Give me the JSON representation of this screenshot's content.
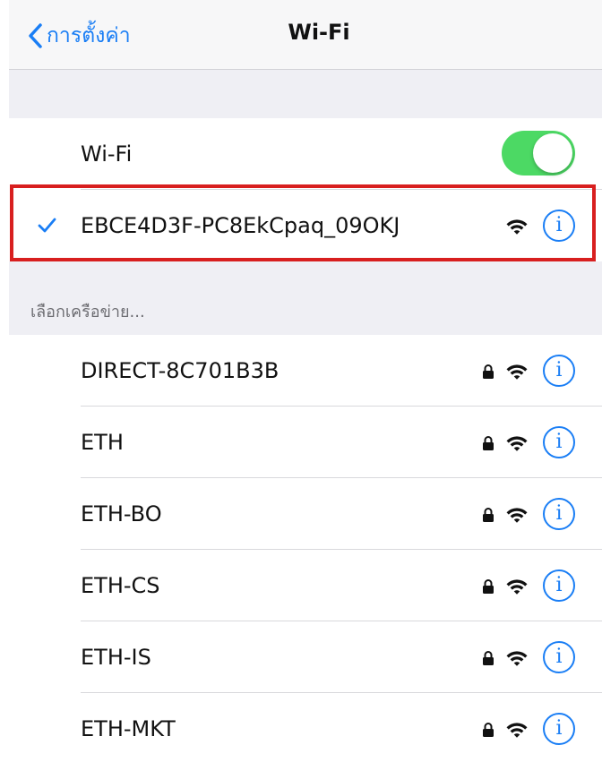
{
  "nav": {
    "back_label": "การตั้งค่า",
    "title": "Wi-Fi"
  },
  "wifi_row": {
    "label": "Wi-Fi",
    "toggle_on": true
  },
  "connected": {
    "ssid": "EBCE4D3F-PC8EkCpaq_09OKJ"
  },
  "section": {
    "header": "เลือกเครือข่าย..."
  },
  "networks": [
    {
      "ssid": "DIRECT-8C701B3B",
      "secured": true
    },
    {
      "ssid": "ETH",
      "secured": true
    },
    {
      "ssid": "ETH-BO",
      "secured": true
    },
    {
      "ssid": "ETH-CS",
      "secured": true
    },
    {
      "ssid": "ETH-IS",
      "secured": true
    },
    {
      "ssid": "ETH-MKT",
      "secured": true
    }
  ],
  "icons": {
    "back": "chevron-left-icon",
    "check": "checkmark-icon",
    "wifi": "wifi-icon",
    "lock": "lock-icon",
    "info": "info-icon"
  },
  "colors": {
    "accent": "#1a7ef5",
    "toggle_on": "#4cd964",
    "highlight": "#d81f1f",
    "group_bg": "#efeff4"
  }
}
